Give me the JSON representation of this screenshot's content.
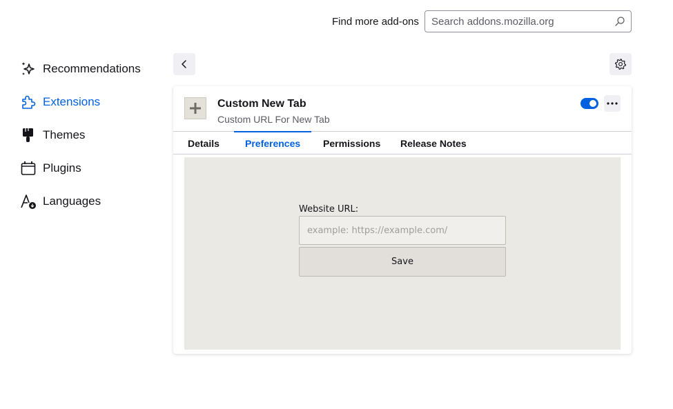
{
  "header": {
    "find_label": "Find more add-ons",
    "search_placeholder": "Search addons.mozilla.org"
  },
  "sidebar": {
    "items": [
      {
        "label": "Recommendations",
        "icon": "sparkle-icon",
        "active": false
      },
      {
        "label": "Extensions",
        "icon": "puzzle-icon",
        "active": true
      },
      {
        "label": "Themes",
        "icon": "paintbrush-icon",
        "active": false
      },
      {
        "label": "Plugins",
        "icon": "plugin-icon",
        "active": false
      },
      {
        "label": "Languages",
        "icon": "language-icon",
        "active": false
      }
    ]
  },
  "addon": {
    "name": "Custom New Tab",
    "description": "Custom URL For New Tab",
    "enabled": true,
    "icon": "plus-icon"
  },
  "tabs": [
    {
      "label": "Details",
      "active": false
    },
    {
      "label": "Preferences",
      "active": true
    },
    {
      "label": "Permissions",
      "active": false
    },
    {
      "label": "Release Notes",
      "active": false
    }
  ],
  "preferences": {
    "url_label": "Website URL:",
    "url_placeholder": "example: https://example.com/",
    "save_label": "Save"
  },
  "colors": {
    "accent": "#0061e0",
    "pane_bg": "#ebe9e4"
  }
}
